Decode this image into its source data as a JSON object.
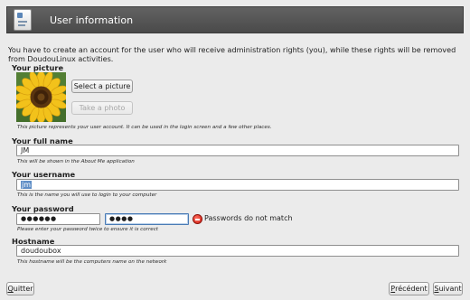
{
  "header": {
    "title": "User information",
    "icon": "user-settings-icon"
  },
  "intro": "You have to create an account for the user who will receive administration rights (you), while these rights will be removed from DoudouLinux activities.",
  "picture": {
    "title": "Your picture",
    "select_label": "Select a picture",
    "photo_label": "Take a photo",
    "note": "This picture represents your user account. It can be used in the login screen and a few other places."
  },
  "full_name": {
    "title": "Your full name",
    "value": "JM",
    "note": "This will be shown in the About Me application"
  },
  "username": {
    "title": "Your username",
    "value": "jm",
    "note": "This is the name you will use to login to your computer"
  },
  "password": {
    "title": "Your password",
    "value1": "●●●●●●",
    "value2": "●●●●",
    "error": "Passwords do not match",
    "error_color": "#d0241a",
    "note": "Please enter your password twice to ensure it is correct"
  },
  "hostname": {
    "title": "Hostname",
    "value": "doudoubox",
    "note": "This hostname will be the computers name on the network"
  },
  "footer": {
    "quit_first": "Q",
    "quit_rest": "uitter",
    "back_first": "P",
    "back_rest": "récédent",
    "next_first": "S",
    "next_rest": "uivant"
  }
}
